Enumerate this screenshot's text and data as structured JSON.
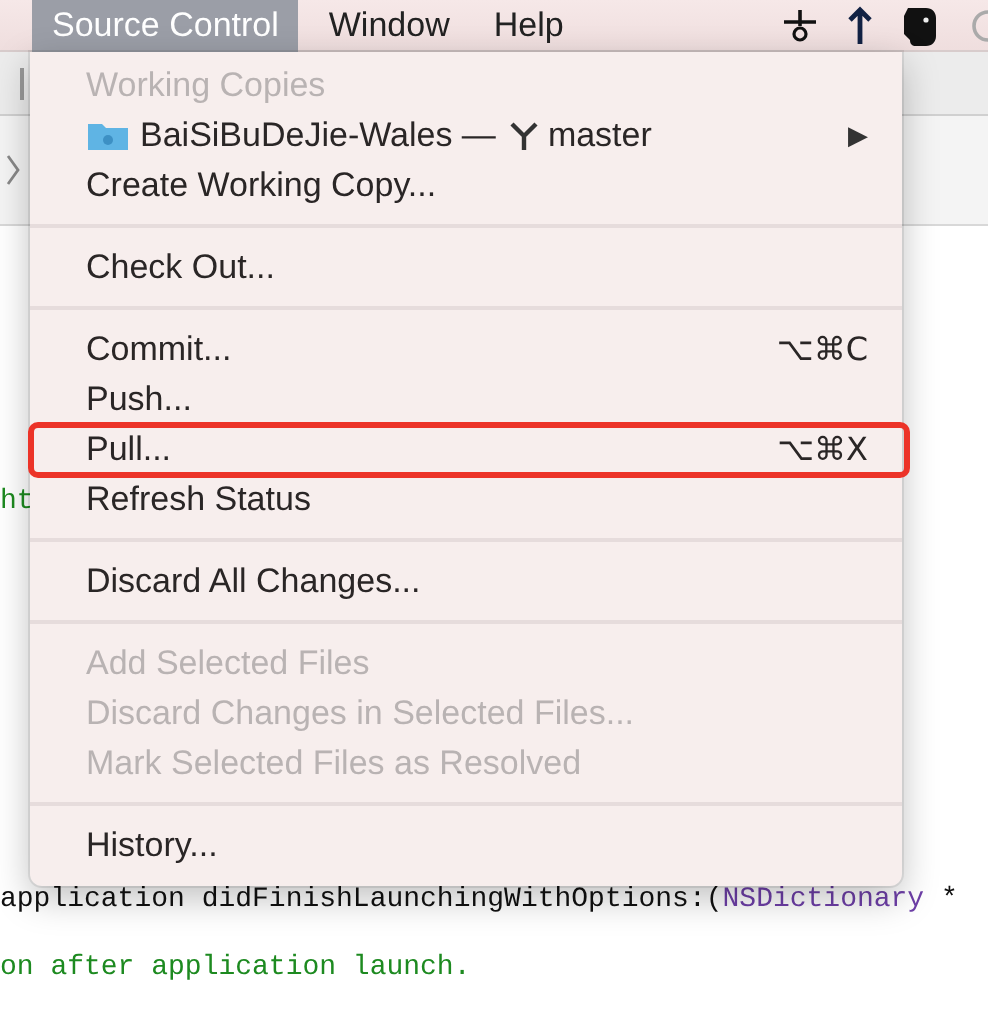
{
  "menu_bar": {
    "items": [
      {
        "label": "Source Control",
        "selected": true
      },
      {
        "label": "Window",
        "selected": false
      },
      {
        "label": "Help",
        "selected": false
      }
    ]
  },
  "menu": {
    "items": [
      {
        "kind": "header",
        "label": "Working Copies"
      },
      {
        "kind": "submenu",
        "label": "BaiSiBuDeJie-Wales —",
        "branch": "master",
        "arrow": "▶"
      },
      {
        "kind": "item",
        "label": "Create Working Copy...",
        "disabled": false,
        "highlighted": false
      },
      {
        "kind": "separator"
      },
      {
        "kind": "item",
        "label": "Check Out...",
        "disabled": false,
        "highlighted": false
      },
      {
        "kind": "separator"
      },
      {
        "kind": "item",
        "label": "Commit...",
        "shortcut": "⌥⌘C",
        "disabled": false,
        "highlighted": false
      },
      {
        "kind": "item",
        "label": "Push...",
        "disabled": false,
        "highlighted": false
      },
      {
        "kind": "item",
        "label": "Pull...",
        "shortcut": "⌥⌘X",
        "disabled": false,
        "highlighted": true
      },
      {
        "kind": "item",
        "label": "Refresh Status",
        "disabled": false,
        "highlighted": false
      },
      {
        "kind": "separator"
      },
      {
        "kind": "item",
        "label": "Discard All Changes...",
        "disabled": false,
        "highlighted": false
      },
      {
        "kind": "separator"
      },
      {
        "kind": "item",
        "label": "Add Selected Files",
        "disabled": true,
        "highlighted": false
      },
      {
        "kind": "item",
        "label": "Discard Changes in Selected Files...",
        "disabled": true,
        "highlighted": false
      },
      {
        "kind": "item",
        "label": "Mark Selected Files as Resolved",
        "disabled": true,
        "highlighted": false
      },
      {
        "kind": "separator"
      },
      {
        "kind": "item",
        "label": "History...",
        "disabled": false,
        "highlighted": false
      }
    ]
  },
  "editor": {
    "fragment": "ht",
    "code_lines": [
      {
        "tokens": [
          {
            "text": "application didFinishLaunchingWithOptions:(",
            "kind": "plain"
          },
          {
            "text": "NSDictionary",
            "kind": "type"
          },
          {
            "text": " *",
            "kind": "plain"
          }
        ]
      },
      {
        "tokens": [
          {
            "text": "on after application launch.",
            "kind": "comment"
          }
        ]
      }
    ]
  }
}
